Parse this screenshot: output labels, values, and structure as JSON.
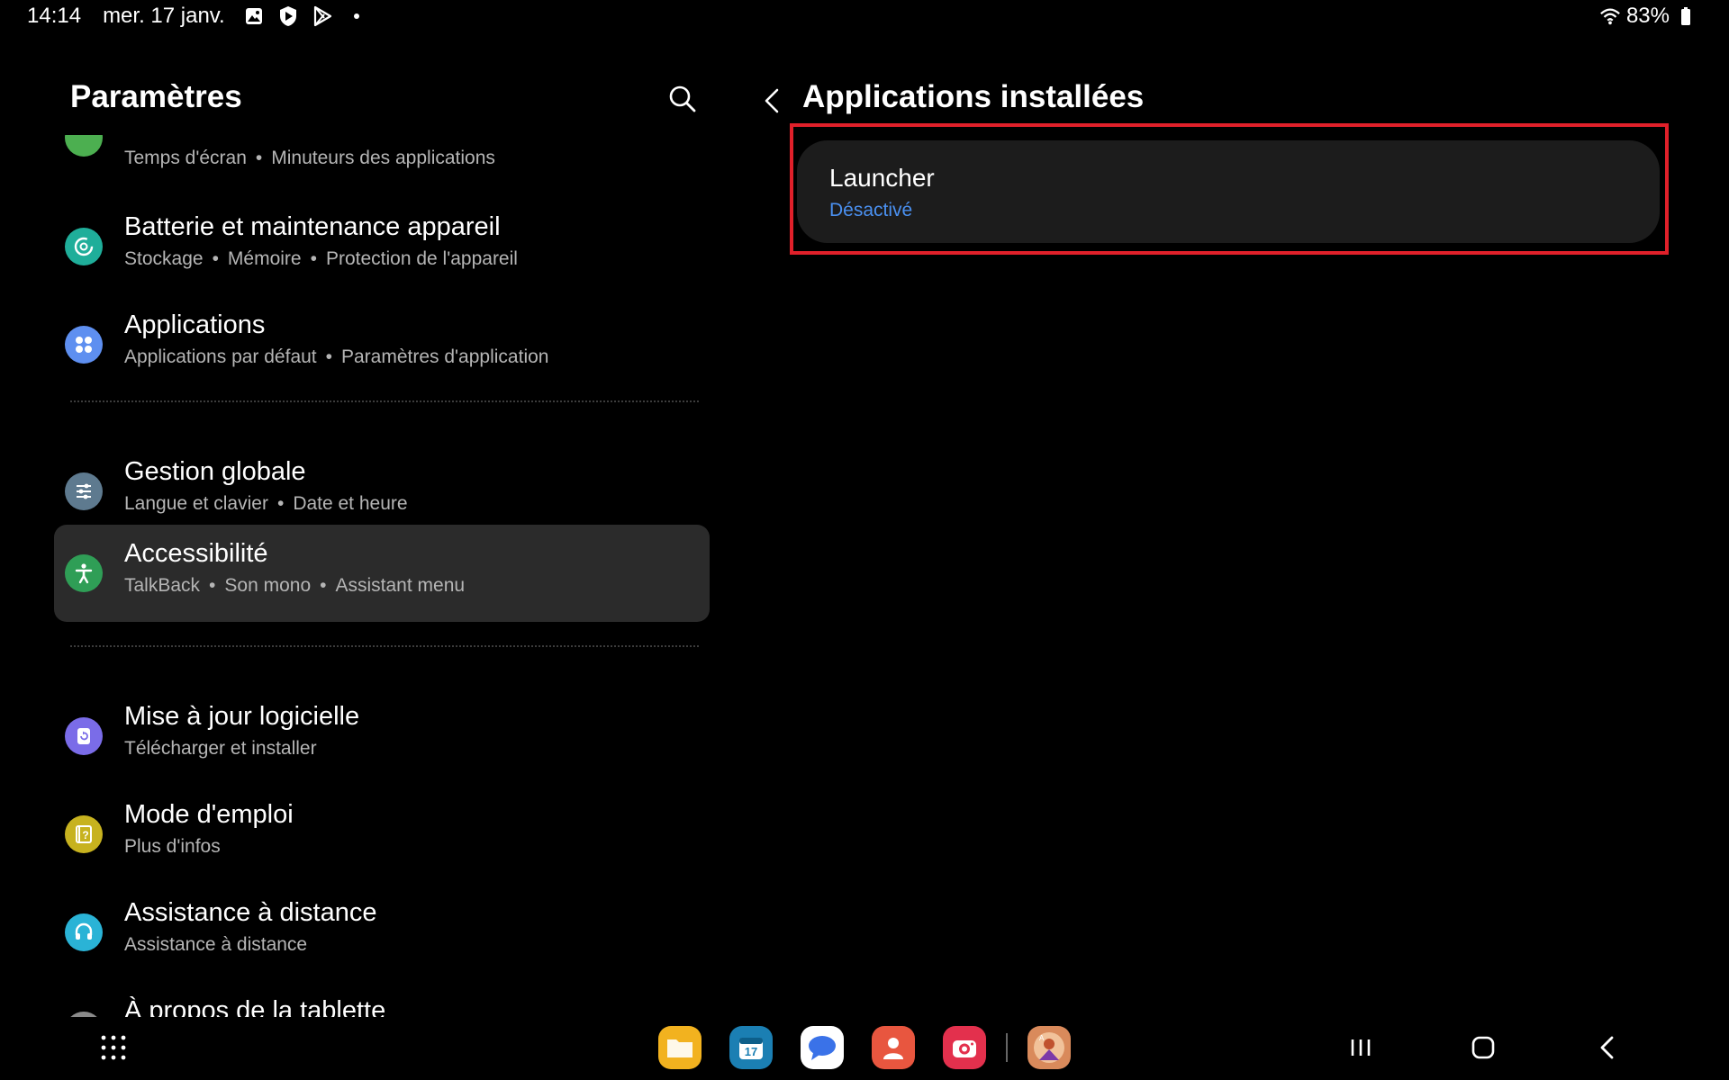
{
  "status_bar": {
    "time": "14:14",
    "date": "mer. 17 janv.",
    "battery": "83%",
    "icons": [
      "gallery-icon",
      "shield-play-icon",
      "play-store-icon",
      "notification-dot-icon",
      "wifi-icon",
      "battery-icon"
    ]
  },
  "left_panel": {
    "title": "Paramètres",
    "partial_top_item": {
      "sub": [
        "Temps d'écran",
        "Minuteurs des applications"
      ],
      "icon_color": "#4caf50"
    },
    "items": [
      {
        "title": "Batterie et maintenance appareil",
        "sub": [
          "Stockage",
          "Mémoire",
          "Protection de l'appareil"
        ],
        "icon_color": "#1fae9a"
      },
      {
        "title": "Applications",
        "sub": [
          "Applications par défaut",
          "Paramètres d'application"
        ],
        "icon_color": "#5e8ff0"
      },
      {
        "title": "Gestion globale",
        "sub": [
          "Langue et clavier",
          "Date et heure"
        ],
        "icon_color": "#5e7a8f"
      },
      {
        "title": "Accessibilité",
        "sub": [
          "TalkBack",
          "Son mono",
          "Assistant menu"
        ],
        "icon_color": "#2f9e56"
      },
      {
        "title": "Mise à jour logicielle",
        "sub": [
          "Télécharger et installer"
        ],
        "icon_color": "#7a6ce8"
      },
      {
        "title": "Mode d'emploi",
        "sub": [
          "Plus d'infos"
        ],
        "icon_color": "#c7b21f"
      },
      {
        "title": "Assistance à distance",
        "sub": [
          "Assistance à distance"
        ],
        "icon_color": "#2ab3d6"
      },
      {
        "title": "À propos de la tablette",
        "sub": [],
        "icon_color": "#8a8a8a"
      }
    ]
  },
  "right_panel": {
    "title": "Applications installées",
    "app": {
      "name": "Launcher",
      "status": "Désactivé"
    }
  },
  "nav_bar": {
    "calendar_day": "17",
    "dock_apps": [
      "my-files-icon",
      "calendar-icon",
      "messages-icon",
      "contacts-icon",
      "camera-icon",
      "game-app-icon"
    ]
  },
  "colors": {
    "background": "#000000",
    "selected_item": "#2b2b2b",
    "status_blue": "#4a90f0",
    "highlight_red": "#e0202a"
  }
}
